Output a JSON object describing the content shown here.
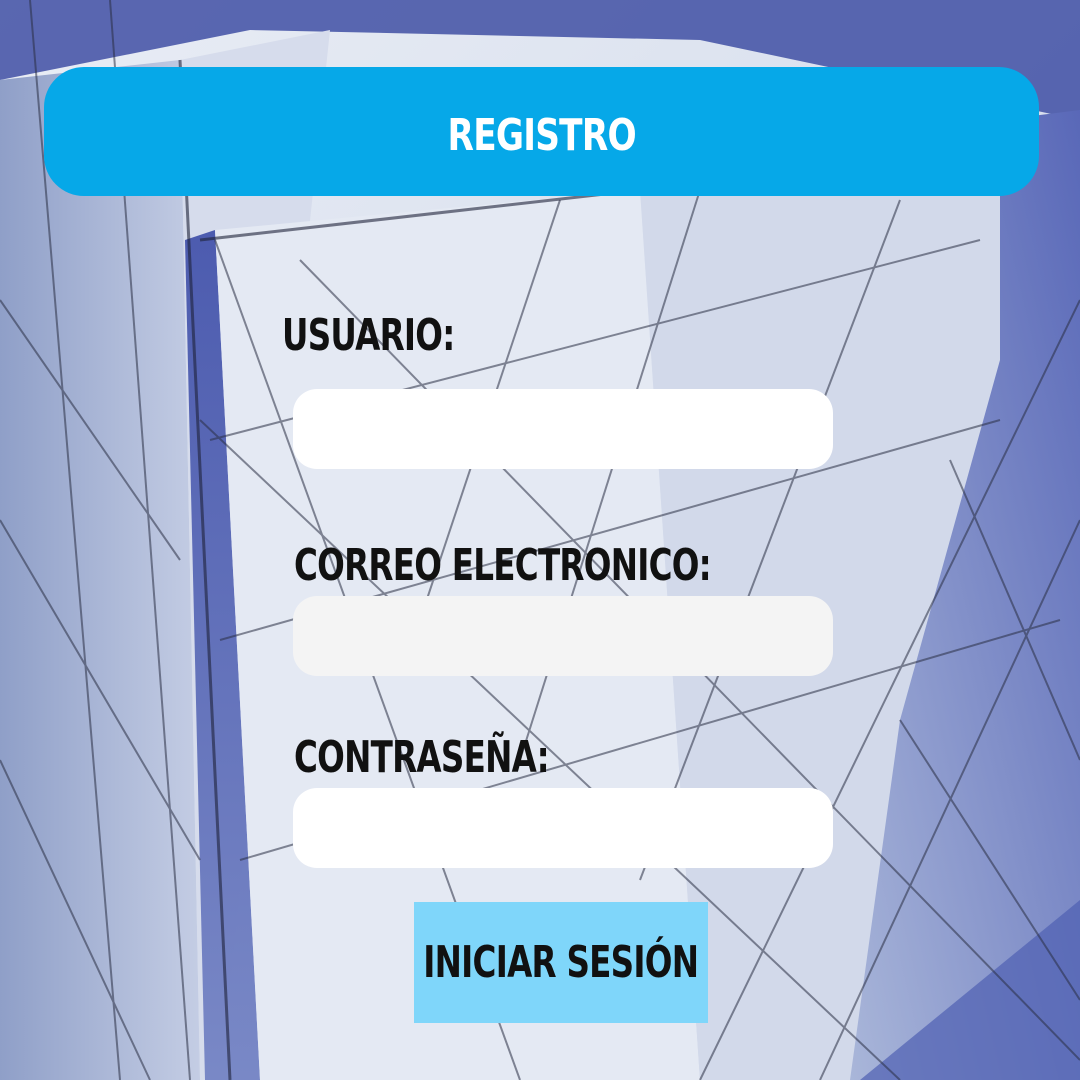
{
  "header": {
    "title": "REGISTRO"
  },
  "form": {
    "username": {
      "label": "USUARIO:",
      "value": "",
      "placeholder": ""
    },
    "email": {
      "label": "CORREO ELECTRONICO:",
      "value": "",
      "placeholder": ""
    },
    "password": {
      "label": "CONTRASEÑA:",
      "value": "",
      "placeholder": ""
    },
    "submit_label": "INICIAR SESIÓN"
  },
  "colors": {
    "header_bar": "#06a8e8",
    "header_text": "#ffffff",
    "submit_button": "#7fd6fa",
    "label_text": "#111111"
  },
  "background": {
    "icon": "glass-building-facade-photo"
  }
}
